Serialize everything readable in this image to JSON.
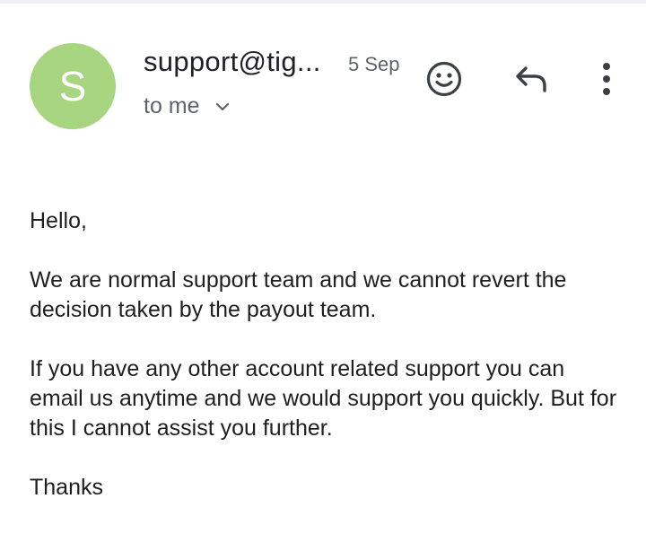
{
  "header": {
    "avatar_letter": "S",
    "avatar_color": "#a8d57f",
    "sender": "support@tig...",
    "date": "5 Sep",
    "recipient": "to me",
    "icons": {
      "expand": "chevron-down-icon",
      "emoji": "emoji-reaction-icon",
      "reply": "reply-icon",
      "more": "more-vert-icon"
    }
  },
  "message": {
    "greeting": "Hello,",
    "paragraph_1": "We are normal support team and we cannot revert the decision taken by the payout team.",
    "paragraph_2": "If you have any other account related support you can email us anytime and we would support you quickly. But for this I cannot assist you further.",
    "closing": "Thanks"
  }
}
